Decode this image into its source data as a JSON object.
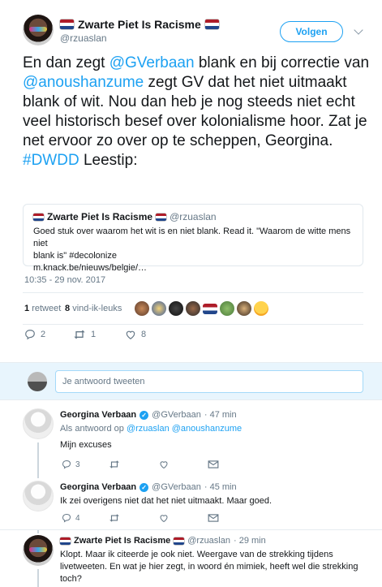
{
  "tweet": {
    "author_name": "Zwarte Piet Is Racisme",
    "author_handle": "@rzuaslan",
    "follow_label": "Volgen",
    "text_parts": [
      {
        "t": "En dan zegt ",
        "link": false
      },
      {
        "t": "@GVerbaan",
        "link": true
      },
      {
        "t": " blank en bij correctie van ",
        "link": false
      },
      {
        "t": "@anoushanzume",
        "link": true
      },
      {
        "t": " zegt GV dat het niet uitmaakt blank of wit. Nou dan heb je nog steeds niet echt veel historisch besef over kolonialisme hoor. Zat je net ervoor zo over op te scheppen, Georgina. ",
        "link": false
      },
      {
        "t": "#DWDD",
        "link": true
      },
      {
        "t": " Leestip:",
        "link": false
      }
    ],
    "quote": {
      "author_name": "Zwarte Piet Is Racisme",
      "author_handle": "@rzuaslan",
      "text_line1": "Goed stuk over waarom het wit is en niet blank. Read it. \"Waarom de witte mens niet",
      "text_line2": "blank is\" #decolonize",
      "text_line3": "m.knack.be/nieuws/belgie/…"
    },
    "timestamp": "10:35 - 29 nov. 2017",
    "retweets_count": "1",
    "retweets_label": "retweet",
    "likes_count": "8",
    "likes_label": "vind-ik-leuks",
    "actions": {
      "reply_count": "2",
      "retweet_count": "1",
      "like_count": "8"
    }
  },
  "reply_box": {
    "placeholder": "Je antwoord tweeten"
  },
  "replies": [
    {
      "name": "Georgina Verbaan",
      "handle": "@GVerbaan",
      "time": "· 47 min",
      "reply_to_prefix": "Als antwoord op",
      "reply_to_handles": "@rzuaslan @anoushanzume",
      "text": "Mijn excuses",
      "reply_count": "3",
      "retweet_count": "",
      "like_count": ""
    },
    {
      "name": "Georgina Verbaan",
      "handle": "@GVerbaan",
      "time": "· 45 min",
      "text": "Ik zei overigens niet dat het niet uitmaakt. Maar goed.",
      "reply_count": "4",
      "retweet_count": "",
      "like_count": ""
    },
    {
      "name": "Zwarte Piet Is Racisme",
      "handle": "@rzuaslan",
      "time": "· 29 min",
      "text_line1": "Klopt. Maar ik citeerde je ook niet. Weergave van de strekking tijdens",
      "text_line2": "livetweeten. En wat je hier zegt, in woord én mimiek, heeft wel die strekking",
      "text_line3": "toch?"
    }
  ],
  "colors": {
    "accent": "#1da1f2",
    "muted": "#657786",
    "like_red": "#e0245e",
    "reply_bg": "#e8f5fd"
  },
  "icons": [
    "caret-down-icon",
    "reply-icon",
    "retweet-icon",
    "heart-icon",
    "mail-icon",
    "verified-icon",
    "netherlands-flag-icon"
  ]
}
